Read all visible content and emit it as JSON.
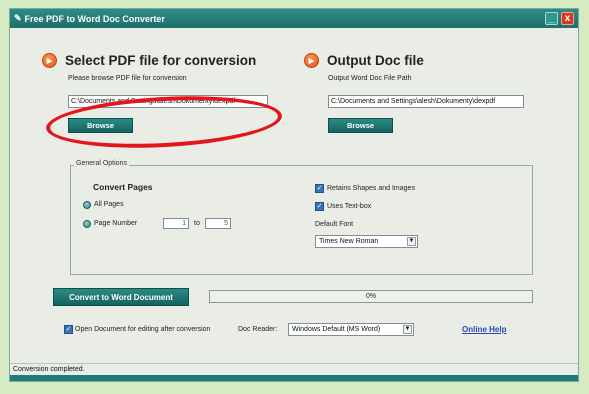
{
  "window": {
    "title": "Free PDF to Word Doc Converter",
    "minimize_glyph": "_",
    "close_glyph": "x"
  },
  "input_section": {
    "heading": "Select PDF file for conversion",
    "subtitle": "Please browse PDF file for conversion",
    "path_value": "C:\\Documents and Settings\\alesh\\Dokumenty\\dexpdf",
    "browse_label": "Browse"
  },
  "output_section": {
    "heading": "Output Doc file",
    "subtitle": "Output Word Doc File Path",
    "path_value": "C:\\Documents and Settings\\alesh\\Dokumenty\\dexpdf",
    "browse_label": "Browse"
  },
  "general_options": {
    "legend": "General Options",
    "convert_pages_label": "Convert Pages",
    "all_pages_label": "All Pages",
    "page_number_label": "Page Number",
    "page_from": "1",
    "to_label": "to",
    "page_to": "5",
    "retains_shapes_label": "Retains Shapes and Images",
    "uses_textbox_label": "Uses Text-box",
    "default_font_label": "Default Font",
    "default_font_value": "Times New Roman",
    "retains_shapes_checked": true,
    "uses_textbox_checked": true,
    "all_pages_selected": true
  },
  "actions": {
    "convert_label": "Convert to Word Document",
    "progress_text": "0%",
    "progress_value": 0
  },
  "bottom": {
    "open_doc_label": "Open Document for editing after conversion",
    "open_doc_checked": true,
    "doc_reader_label": "Doc Reader:",
    "doc_reader_value": "Windows Default (MS Word)",
    "help_link": "Online Help"
  },
  "status": {
    "text": "Conversion completed."
  },
  "colors": {
    "accent_teal": "#1f6f6b",
    "annotation_red": "#e3161c",
    "background_green": "#d6ebc1"
  }
}
